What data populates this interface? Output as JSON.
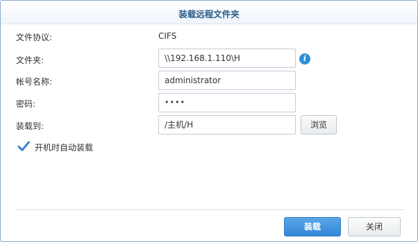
{
  "dialog": {
    "title": "装载远程文件夹"
  },
  "form": {
    "protocol_label": "文件协议:",
    "protocol_value": "CIFS",
    "folder_label": "文件夹:",
    "folder_value": "\\\\192.168.1.110\\H",
    "account_label": "帐号名称:",
    "account_value": "administrator",
    "password_label": "密码:",
    "password_value": "••••",
    "mount_label": "装载到:",
    "mount_value": "/主机/H",
    "browse_label": "浏览",
    "automount_label": "开机时自动装载",
    "automount_checked": true
  },
  "footer": {
    "mount_button": "装载",
    "close_button": "关闭"
  },
  "colors": {
    "title": "#2c5d8a",
    "primary_button": "#3486d4",
    "info_icon": "#2d8ed8",
    "checkmark": "#2f7fd1"
  },
  "icons": {
    "info": "info-icon",
    "checkbox": "checkmark-icon"
  }
}
